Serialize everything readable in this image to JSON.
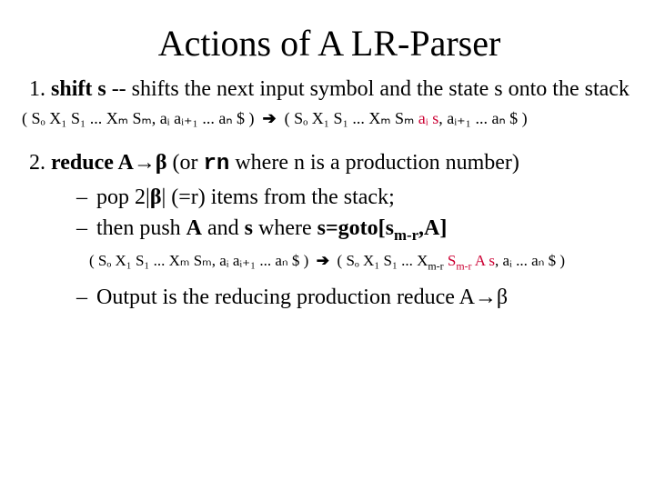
{
  "title": "Actions of A LR-Parser",
  "item1": {
    "label_bold": "shift s",
    "label_rest": "  -- shifts the next input symbol and the state s onto the stack",
    "formula_left": "( Sₒ X₁ S₁ ... Xₘ Sₘ, aᵢ aᵢ₊₁ ... aₙ $ )",
    "arrow": "➔",
    "formula_right_pre": "( Sₒ X₁ S₁ ... Xₘ Sₘ ",
    "formula_right_red": "aᵢ s",
    "formula_right_post": ", aᵢ₊₁ ... aₙ $ )"
  },
  "item2": {
    "label_bold_a": "reduce A",
    "label_arrow": "→",
    "label_bold_b": "β",
    "label_paren_pre": "   (or ",
    "label_rn": "rn",
    "label_paren_post": " where n is a production number)",
    "bullet1": "pop 2|β|  (=r) items from the stack;",
    "bullet2_pre": "then push ",
    "bullet2_A": "A",
    "bullet2_mid": " and ",
    "bullet2_s": "s",
    "bullet2_where": "  where  ",
    "bullet2_goto": "s=goto[s",
    "bullet2_goto_sub": "m-r",
    "bullet2_goto_post": ",A]",
    "formula_left": "( Sₒ X₁ S₁ ... Xₘ Sₘ, aᵢ aᵢ₊₁ ... aₙ $ )",
    "arrow2": "➔",
    "formula_right_pre": "( Sₒ X₁ S₁ ... X",
    "formula_right_sub1": "m-r",
    "formula_right_mid": " ",
    "formula_right_red_a": "S",
    "formula_right_red_sub": "m-r",
    "formula_right_red_b": " A s",
    "formula_right_post": ", aᵢ ... aₙ $ )",
    "bullet3": "Output is the reducing production reduce A→β"
  }
}
